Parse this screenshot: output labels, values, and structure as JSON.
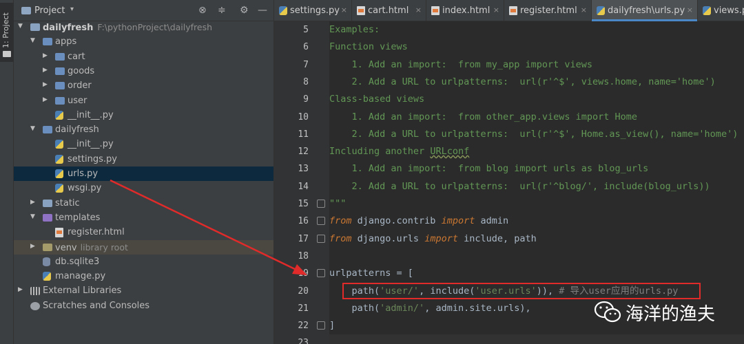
{
  "tool_window": {
    "stripe_label": "1: Project"
  },
  "project_panel": {
    "title": "Project",
    "dropdown": "▾",
    "header_icons": [
      "target-icon",
      "collapse-icon",
      "gear-icon",
      "minimize-icon"
    ],
    "tree": [
      {
        "label": "dailyfresh",
        "extra": "F:\\pythonProject\\dailyfresh",
        "depth": 0,
        "expanded": true,
        "icon": "folder",
        "bold": true
      },
      {
        "label": "apps",
        "depth": 1,
        "expanded": true,
        "icon": "folder-blue"
      },
      {
        "label": "cart",
        "depth": 2,
        "expanded": false,
        "icon": "folder-blue"
      },
      {
        "label": "goods",
        "depth": 2,
        "expanded": false,
        "icon": "folder-blue"
      },
      {
        "label": "order",
        "depth": 2,
        "expanded": false,
        "icon": "folder-blue"
      },
      {
        "label": "user",
        "depth": 2,
        "expanded": false,
        "icon": "folder-blue"
      },
      {
        "label": "__init__.py",
        "depth": 2,
        "icon": "py"
      },
      {
        "label": "dailyfresh",
        "depth": 1,
        "expanded": true,
        "icon": "folder-blue"
      },
      {
        "label": "__init__.py",
        "depth": 2,
        "icon": "py"
      },
      {
        "label": "settings.py",
        "depth": 2,
        "icon": "py"
      },
      {
        "label": "urls.py",
        "depth": 2,
        "icon": "py",
        "selected": true
      },
      {
        "label": "wsgi.py",
        "depth": 2,
        "icon": "py"
      },
      {
        "label": "static",
        "depth": 1,
        "expanded": false,
        "icon": "folder"
      },
      {
        "label": "templates",
        "depth": 1,
        "expanded": true,
        "icon": "folder-purple"
      },
      {
        "label": "register.html",
        "depth": 2,
        "icon": "html"
      },
      {
        "label": "venv",
        "extra": "library root",
        "depth": 1,
        "expanded": false,
        "icon": "folder-olive",
        "venv": true
      },
      {
        "label": "db.sqlite3",
        "depth": 1,
        "icon": "db"
      },
      {
        "label": "manage.py",
        "depth": 1,
        "icon": "py"
      },
      {
        "label": "External Libraries",
        "depth": 0,
        "expanded": false,
        "icon": "lib"
      },
      {
        "label": "Scratches and Consoles",
        "depth": 0,
        "icon": "scratch"
      }
    ]
  },
  "editor": {
    "tabs": [
      {
        "label": "settings.py",
        "icon": "py"
      },
      {
        "label": "cart.html",
        "icon": "html"
      },
      {
        "label": "index.html",
        "icon": "html"
      },
      {
        "label": "register.html",
        "icon": "html"
      },
      {
        "label": "dailyfresh\\urls.py",
        "icon": "py",
        "active": true
      },
      {
        "label": "views.py",
        "icon": "py"
      }
    ],
    "close_glyph": "×",
    "line_numbers": [
      "5",
      "6",
      "7",
      "8",
      "9",
      "10",
      "11",
      "12",
      "13",
      "14",
      "15",
      "16",
      "17",
      "18",
      "19",
      "20",
      "21",
      "22",
      "23"
    ],
    "lines": [
      [
        {
          "t": "Examples:",
          "c": "doc"
        }
      ],
      [
        {
          "t": "Function views",
          "c": "doc"
        }
      ],
      [
        {
          "t": "    1. Add an import:  from my_app import views",
          "c": "doc"
        }
      ],
      [
        {
          "t": "    2. Add a URL to urlpatterns:  url(r'^$', views.home, name='home')",
          "c": "doc"
        }
      ],
      [
        {
          "t": "Class-based views",
          "c": "doc"
        }
      ],
      [
        {
          "t": "    1. Add an import:  from other_app.views import Home",
          "c": "doc"
        }
      ],
      [
        {
          "t": "    2. Add a URL to urlpatterns:  url(r'^$', Home.as_view(), name='home')",
          "c": "doc"
        }
      ],
      [
        {
          "t": "Including another ",
          "c": "doc"
        },
        {
          "t": "URLconf",
          "c": "doc wave"
        }
      ],
      [
        {
          "t": "    1. Add an import:  from blog import urls as blog_urls",
          "c": "doc"
        }
      ],
      [
        {
          "t": "    2. Add a URL to urlpatterns:  url(r'^blog/', include(blog_urls))",
          "c": "doc"
        }
      ],
      [
        {
          "t": "\"\"\"",
          "c": "doc"
        }
      ],
      [
        {
          "t": "from",
          "c": "kw"
        },
        {
          "t": " django.contrib ",
          "c": "var"
        },
        {
          "t": "import",
          "c": "kw"
        },
        {
          "t": " admin",
          "c": "var"
        }
      ],
      [
        {
          "t": "from",
          "c": "kw"
        },
        {
          "t": " django.urls ",
          "c": "var"
        },
        {
          "t": "import",
          "c": "kw"
        },
        {
          "t": " include, path",
          "c": "var"
        }
      ],
      [
        {
          "t": "",
          "c": "var"
        }
      ],
      [
        {
          "t": "urlpatterns = [",
          "c": "var"
        }
      ],
      [
        {
          "t": "    path(",
          "c": "var"
        },
        {
          "t": "'user/'",
          "c": "str"
        },
        {
          "t": ", include(",
          "c": "var"
        },
        {
          "t": "'user.urls'",
          "c": "str"
        },
        {
          "t": ")), ",
          "c": "var"
        },
        {
          "t": "# 导入user应用的urls.py",
          "c": "com"
        }
      ],
      [
        {
          "t": "    path(",
          "c": "var"
        },
        {
          "t": "'admin/'",
          "c": "str"
        },
        {
          "t": ", admin.site.urls),",
          "c": "var"
        }
      ],
      [
        {
          "t": "]",
          "c": "var"
        }
      ],
      [
        {
          "t": "",
          "c": "var"
        }
      ]
    ],
    "fold_markers": [
      "15",
      "16",
      "17",
      "19",
      "22"
    ],
    "current_line": "23"
  },
  "watermark": {
    "text": "海洋的渔夫",
    "logo": "wechat-logo"
  },
  "colors": {
    "highlight_box": "#e12a2a",
    "annotation_arrow": "#e12a2a",
    "active_tab_underline": "#4a88c7",
    "selection": "#0d293e"
  }
}
